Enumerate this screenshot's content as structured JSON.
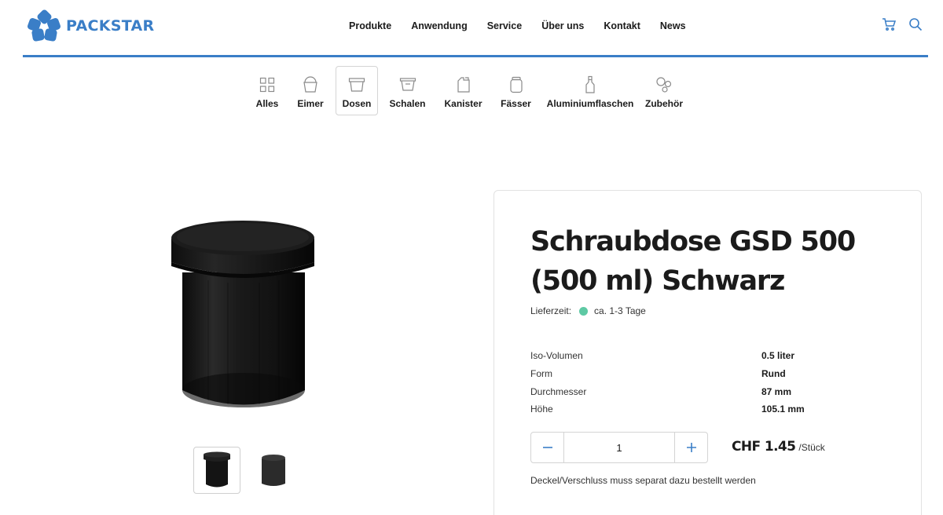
{
  "brand": {
    "name": "PACKSTAR",
    "color": "#3a7ec7"
  },
  "nav": [
    {
      "label": "Produkte"
    },
    {
      "label": "Anwendung"
    },
    {
      "label": "Service"
    },
    {
      "label": "Über uns"
    },
    {
      "label": "Kontakt"
    },
    {
      "label": "News"
    }
  ],
  "header_icons": [
    "cart-icon",
    "search-icon"
  ],
  "categories": [
    {
      "label": "Alles",
      "icon": "grid-icon"
    },
    {
      "label": "Eimer",
      "icon": "bucket-icon"
    },
    {
      "label": "Dosen",
      "icon": "jar-icon",
      "active": true
    },
    {
      "label": "Schalen",
      "icon": "tray-icon"
    },
    {
      "label": "Kanister",
      "icon": "canister-icon"
    },
    {
      "label": "Fässer",
      "icon": "barrel-icon"
    },
    {
      "label": "Aluminiumflaschen",
      "icon": "bottle-icon"
    },
    {
      "label": "Zubehör",
      "icon": "accessories-icon"
    }
  ],
  "product": {
    "title_line1": "Schraubdose GSD 500",
    "title_line2": "(500 ml) Schwarz",
    "delivery_label": "Lieferzeit:",
    "delivery_value": "ca. 1-3 Tage",
    "delivery_color": "#5ec9a4",
    "specs": [
      {
        "key": "Iso-Volumen",
        "value": "0.5 liter"
      },
      {
        "key": "Form",
        "value": "Rund"
      },
      {
        "key": "Durchmesser",
        "value": "87 mm"
      },
      {
        "key": "Höhe",
        "value": "105.1 mm"
      }
    ],
    "quantity": "1",
    "price": "CHF 1.45",
    "price_unit": "/Stück",
    "note": "Deckel/Verschluss muss separat dazu bestellt werden"
  },
  "gallery": {
    "thumbnails": [
      "jar-with-lid",
      "jar-body"
    ],
    "active_index": 0
  }
}
